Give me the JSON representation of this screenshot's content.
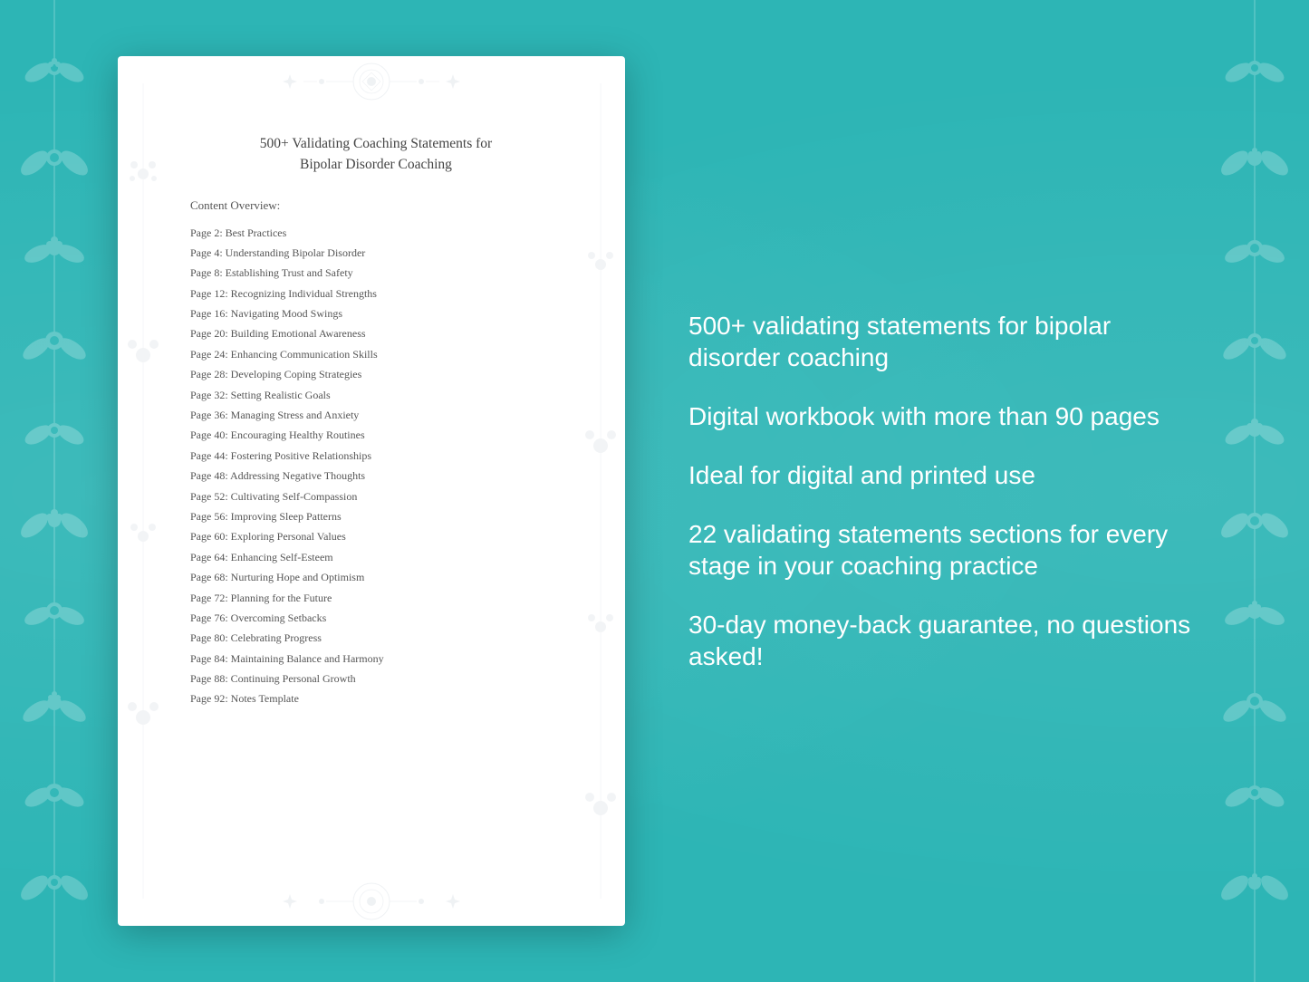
{
  "background": {
    "color": "#3dbfbf"
  },
  "document": {
    "title_line1": "500+ Validating Coaching Statements for",
    "title_line2": "Bipolar Disorder Coaching",
    "content_label": "Content Overview:",
    "toc": [
      {
        "page": "Page  2:",
        "topic": "Best Practices"
      },
      {
        "page": "Page  4:",
        "topic": "Understanding Bipolar Disorder"
      },
      {
        "page": "Page  8:",
        "topic": "Establishing Trust and Safety"
      },
      {
        "page": "Page 12:",
        "topic": "Recognizing Individual Strengths"
      },
      {
        "page": "Page 16:",
        "topic": "Navigating Mood Swings"
      },
      {
        "page": "Page 20:",
        "topic": "Building Emotional Awareness"
      },
      {
        "page": "Page 24:",
        "topic": "Enhancing Communication Skills"
      },
      {
        "page": "Page 28:",
        "topic": "Developing Coping Strategies"
      },
      {
        "page": "Page 32:",
        "topic": "Setting Realistic Goals"
      },
      {
        "page": "Page 36:",
        "topic": "Managing Stress and Anxiety"
      },
      {
        "page": "Page 40:",
        "topic": "Encouraging Healthy Routines"
      },
      {
        "page": "Page 44:",
        "topic": "Fostering Positive Relationships"
      },
      {
        "page": "Page 48:",
        "topic": "Addressing Negative Thoughts"
      },
      {
        "page": "Page 52:",
        "topic": "Cultivating Self-Compassion"
      },
      {
        "page": "Page 56:",
        "topic": "Improving Sleep Patterns"
      },
      {
        "page": "Page 60:",
        "topic": "Exploring Personal Values"
      },
      {
        "page": "Page 64:",
        "topic": "Enhancing Self-Esteem"
      },
      {
        "page": "Page 68:",
        "topic": "Nurturing Hope and Optimism"
      },
      {
        "page": "Page 72:",
        "topic": "Planning for the Future"
      },
      {
        "page": "Page 76:",
        "topic": "Overcoming Setbacks"
      },
      {
        "page": "Page 80:",
        "topic": "Celebrating Progress"
      },
      {
        "page": "Page 84:",
        "topic": "Maintaining Balance and Harmony"
      },
      {
        "page": "Page 88:",
        "topic": "Continuing Personal Growth"
      },
      {
        "page": "Page 92:",
        "topic": "Notes Template"
      }
    ]
  },
  "features": [
    "500+ validating statements for bipolar disorder coaching",
    "Digital workbook with more than 90 pages",
    "Ideal for digital and printed use",
    "22 validating statements sections for every stage in your coaching practice",
    "30-day money-back guarantee, no questions asked!"
  ]
}
